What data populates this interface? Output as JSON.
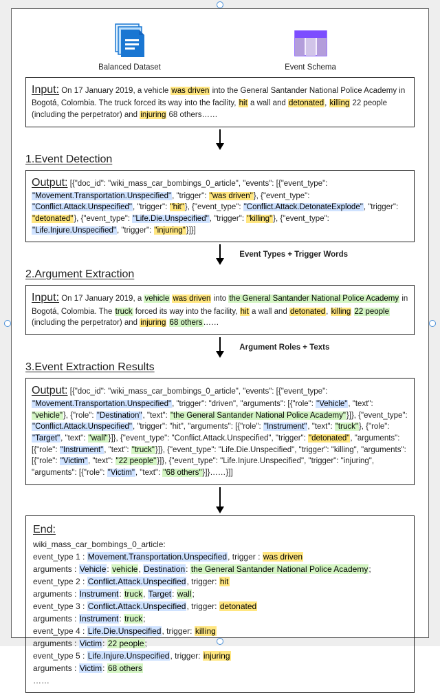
{
  "icons": {
    "dataset_caption": "Balanced Dataset",
    "schema_caption": "Event Schema"
  },
  "input1": {
    "lead": "Input:",
    "pre": "  On 17 January 2019, a vehicle ",
    "t1": "was driven",
    "mid1": " into the General Santander National Police Academy in Bogotá, Colombia. The truck forced its way into the facility, ",
    "t2": "hit",
    "mid2": " a wall and ",
    "t3": "detonated",
    "mid3": ", ",
    "t4": "killing",
    "mid4": " 22 people (including the perpetrator) and ",
    "t5": "injuring",
    "tail": " 68 others……"
  },
  "h1": "1.Event Detection",
  "output1": {
    "lead": "Output:",
    "s1": "  [{\"doc_id\":  \"wiki_mass_car_bombings_0_article\",  \"events\": [{\"event_type\": ",
    "v1": "\"Movement.Transportation.Unspecified\"",
    "s2": ",  \"trigger\":  ",
    "vt1": "\"was driven\"",
    "s3": "}, {\"event_type\":  ",
    "v2": "\"Conflict.Attack.Unspecified\"",
    "s4": ", \"trigger\": ",
    "vt2": "\"hit\"",
    "s5": "}, {\"event_type\":  ",
    "v3": "\"Conflict.Attack.DetonateExplode\"",
    "s6": ", \"trigger\": ",
    "vt3": "\"detonated\"",
    "s7": "}, {\"event_type\": ",
    "v4": "\"Life.Die.Unspecified\"",
    "s8": ",  \"trigger\": ",
    "vt4": "\"killing\"",
    "s9": "}, {\"event_type\":  ",
    "v5": "\"Life.Injure.Unspecified\"",
    "s10": ",  \"trigger\": ",
    "vt5": "\"injuring\"",
    "s11": "}]}]"
  },
  "arrow1_label": "Event Types + Trigger Words",
  "h2": "2.Argument Extraction",
  "input2": {
    "lead": "Input:",
    "pre": "  On 17 January 2019, a ",
    "a1": "vehicle",
    "gap1": " ",
    "t1": "was driven",
    "mid1": " into ",
    "a2": "the General Santander National Police Academy",
    "mid1b": " in Bogotá, Colombia. The ",
    "a3": "truck",
    "mid2": " forced its way into the facility, ",
    "t2": "hit",
    "mid3": " a wall and ",
    "t3": "detonated",
    "mid4": ", ",
    "t4": "killing",
    "gap2": " ",
    "a4": "22 people",
    "mid5": " (including the perpetrator) and ",
    "t5": "injuring",
    "gap3": " ",
    "a5": "68 others",
    "tail": "……"
  },
  "arrow2_label": "Argument Roles + Texts",
  "h3": "3.Event Extraction Results",
  "output2": {
    "lead": "Output:",
    "body_segments": [
      {
        "txt": "  [{\"doc_id\":  \"wiki_mass_car_bombings_0_article\",  \"events\":  [{\"event_type\": "
      },
      {
        "txt": "\"Movement.Transportation.Unspecified\"",
        "hl": "b"
      },
      {
        "txt": ",  \"trigger\": \"driven\", \"arguments\": [{\"role\":  "
      },
      {
        "txt": "\"Vehicle\"",
        "hl": "b"
      },
      {
        "txt": ", \"text\":  "
      },
      {
        "txt": "\"vehicle\"",
        "hl": "g"
      },
      {
        "txt": "}, {\"role\":  "
      },
      {
        "txt": "\"Destination\"",
        "hl": "b"
      },
      {
        "txt": ", \"text\": "
      },
      {
        "txt": "\"the General Santander National Police Academy\"",
        "hl": "g"
      },
      {
        "txt": "}]}, {\"event_type\": "
      },
      {
        "txt": "\"Conflict.Attack.Unspecified\"",
        "hl": "b"
      },
      {
        "txt": ", \"trigger\": \"hit\", \"arguments\": [{\"role\":  "
      },
      {
        "txt": "\"Instrument\"",
        "hl": "b"
      },
      {
        "txt": ", \"text\":  "
      },
      {
        "txt": "\"truck\"",
        "hl": "g"
      },
      {
        "txt": "}, {\"role\":  "
      },
      {
        "txt": "\"Target\"",
        "hl": "b"
      },
      {
        "txt": ", \"text\":  "
      },
      {
        "txt": "\"wall\"",
        "hl": "g"
      },
      {
        "txt": "}]}, {\"event_type\": \"Conflict.Attack.Unspecified\", \"trigger\": "
      },
      {
        "txt": "\"detonated\"",
        "hl": "y"
      },
      {
        "txt": ", \"arguments\": [{\"role\": "
      },
      {
        "txt": "\"Instrument\"",
        "hl": "b"
      },
      {
        "txt": ", \"text\":  "
      },
      {
        "txt": "\"truck\"",
        "hl": "g"
      },
      {
        "txt": "}]}, {\"event_type\": \"Life.Die.Unspecified\", \"trigger\": \"killing\", \"arguments\": [{\"role\": "
      },
      {
        "txt": "\"Victim\"",
        "hl": "b"
      },
      {
        "txt": ", \"text\":  "
      },
      {
        "txt": "\"22 people\"",
        "hl": "g"
      },
      {
        "txt": "}]}, {\"event_type\": \"Life.Injure.Unspecified\", \"trigger\": \"injuring\", \"arguments\": [{\"role\": "
      },
      {
        "txt": "\"Victim\"",
        "hl": "b"
      },
      {
        "txt": ", \"text\":  "
      },
      {
        "txt": "\"68 others\"",
        "hl": "g"
      },
      {
        "txt": "}]}……}]]"
      }
    ]
  },
  "end": {
    "lead": "End:",
    "doc": "wiki_mass_car_bombings_0_article:",
    "lines": [
      {
        "plain": "event_type 1 : ",
        "et": "Movement.Transportation.Unspecified",
        "mid": ", trigger : ",
        "trg": "was driven",
        "trg_hl": "y"
      },
      {
        "args_lead": "arguments : ",
        "roles": [
          {
            "r": "Vehicle",
            "t": "vehicle"
          },
          {
            "r": "Destination",
            "t": "the General Santander National Police Academy"
          }
        ],
        "semi": ";"
      },
      {
        "plain": "event_type 2 : ",
        "et": "Conflict.Attack.Unspecified",
        "mid": ", trigger: ",
        "trg": "hit",
        "trg_hl": "y"
      },
      {
        "args_lead": "arguments : ",
        "roles": [
          {
            "r": "Instrument",
            "t": "truck"
          },
          {
            "r": "Target",
            "t": "wall"
          }
        ],
        "semi": ";"
      },
      {
        "plain": "event_type 3 : ",
        "et": "Conflict.Attack.Unspecified",
        "mid": ", trigger: ",
        "trg": "detonated",
        "trg_hl": "y"
      },
      {
        "args_lead": "arguments : ",
        "roles": [
          {
            "r": "Instrument",
            "t": "truck"
          }
        ],
        "semi": ";"
      },
      {
        "plain": "event_type 4 : ",
        "et": "Life.Die.Unspecified",
        "mid": ", trigger: ",
        "trg": "killing",
        "trg_hl": "y"
      },
      {
        "args_lead": "arguments : ",
        "roles": [
          {
            "r": "Victim",
            "t": "22 people"
          }
        ],
        "semi": ";"
      },
      {
        "plain": "event_type 5 : ",
        "et": "Life.Injure.Unspecified",
        "mid": ", trigger: ",
        "trg": "injuring",
        "trg_hl": "y"
      },
      {
        "args_lead": "arguments : ",
        "roles": [
          {
            "r": "Victim",
            "t": "68 others"
          }
        ],
        "semi": ""
      }
    ],
    "ellipsis": "……"
  }
}
